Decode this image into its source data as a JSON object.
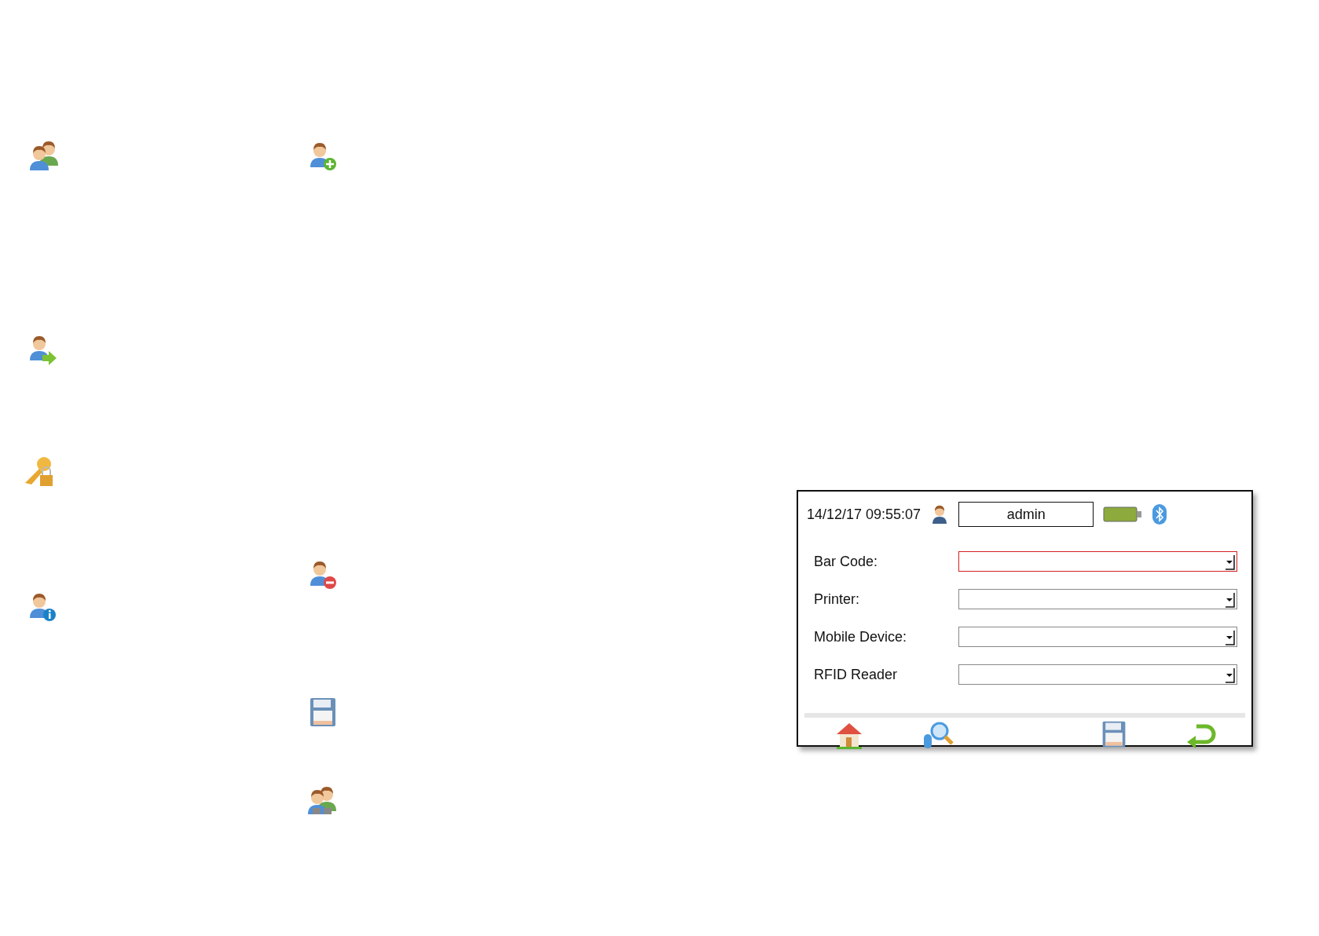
{
  "status_bar": {
    "datetime": "14/12/17 09:55:07",
    "user": "admin"
  },
  "fields": [
    {
      "label": "Bar Code:",
      "invalid": true
    },
    {
      "label": "Printer:",
      "invalid": false
    },
    {
      "label": "Mobile Device:",
      "invalid": false
    },
    {
      "label": "RFID Reader",
      "invalid": false
    }
  ]
}
